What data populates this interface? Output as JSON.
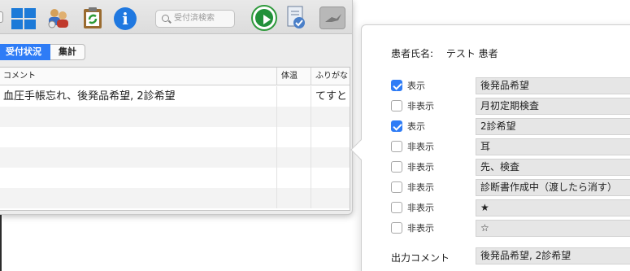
{
  "toolbar": {
    "search_placeholder": "受付済検索",
    "info_glyph": "i",
    "icons": [
      "grid-icon",
      "users-icon",
      "refresh-clipboard-icon",
      "info-icon",
      "search-icon",
      "play-icon",
      "document-icon",
      "bird-icon"
    ]
  },
  "tabs": [
    {
      "label": "受付状況",
      "active": true
    },
    {
      "label": "集計",
      "active": false
    }
  ],
  "table": {
    "columns": [
      "コメント",
      "体温",
      "ふりがな"
    ],
    "rows": [
      {
        "comment": "血圧手帳忘れ、後発品希望, 2診希望",
        "temp": "",
        "furigana": "てすと"
      },
      {
        "comment": "",
        "temp": "",
        "furigana": ""
      },
      {
        "comment": "",
        "temp": "",
        "furigana": ""
      },
      {
        "comment": "",
        "temp": "",
        "furigana": ""
      },
      {
        "comment": "",
        "temp": "",
        "furigana": ""
      },
      {
        "comment": "",
        "temp": "",
        "furigana": ""
      }
    ]
  },
  "popover": {
    "patient_label": "患者氏名:",
    "patient_name": "テスト 患者",
    "options": [
      {
        "checked": true,
        "label": "表示",
        "text": "後発品希望"
      },
      {
        "checked": false,
        "label": "非表示",
        "text": "月初定期検査"
      },
      {
        "checked": true,
        "label": "表示",
        "text": "2診希望"
      },
      {
        "checked": false,
        "label": "非表示",
        "text": "耳"
      },
      {
        "checked": false,
        "label": "非表示",
        "text": "先、検査"
      },
      {
        "checked": false,
        "label": "非表示",
        "text": "診断書作成中（渡したら消す）"
      },
      {
        "checked": false,
        "label": "非表示",
        "text": "★"
      },
      {
        "checked": false,
        "label": "非表示",
        "text": "☆"
      }
    ],
    "output_label": "出力コメント",
    "output_value": "後発品希望, 2診希望"
  },
  "colors": {
    "accent": "#2e7cf6",
    "play_green": "#22913a",
    "info_blue": "#1f78e0"
  }
}
